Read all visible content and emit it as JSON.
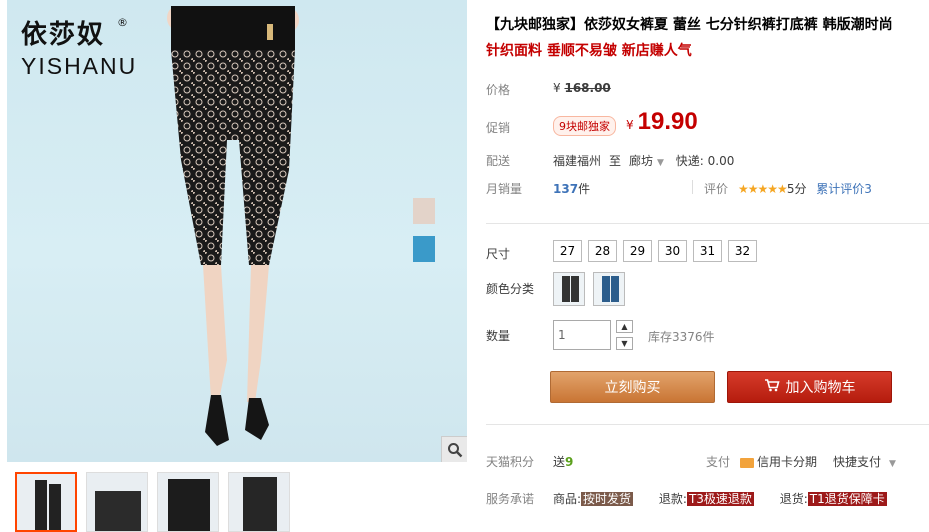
{
  "brand": {
    "name_cn": "依莎奴",
    "name_en": "YISHANU",
    "reg_mark": "®"
  },
  "product": {
    "title": "【九块邮独家】依莎奴女裤夏 蕾丝 七分针织裤打底裤 韩版潮时尚",
    "subtitle": "针织面料 垂顺不易皱 新店赚人气"
  },
  "price": {
    "label": "价格",
    "currency": "¥",
    "original": "168.00"
  },
  "promo": {
    "label": "促销",
    "badge": "9块邮独家",
    "currency": "¥",
    "price": "19.90"
  },
  "shipping": {
    "label": "配送",
    "from": "福建福州",
    "to_word": "至",
    "to": "廊坊",
    "express": "快递: 0.00"
  },
  "sales": {
    "label": "月销量",
    "count": "137",
    "unit": "件"
  },
  "rating": {
    "label": "评价",
    "stars": "★★★★★",
    "score": "5分",
    "cumulative_label": "累计评价",
    "cumulative_count": "3"
  },
  "sizes": {
    "label": "尺寸",
    "options": [
      "27",
      "28",
      "29",
      "30",
      "31",
      "32"
    ]
  },
  "colors": {
    "label": "颜色分类"
  },
  "quantity": {
    "label": "数量",
    "value": "1",
    "stock": "库存3376件"
  },
  "buttons": {
    "buy_now": "立刻购买",
    "add_to_cart": "加入购物车"
  },
  "tmall_points": {
    "label": "天猫积分",
    "send": "送",
    "points": "9"
  },
  "payment": {
    "label": "支付",
    "credit": "信用卡分期",
    "quick": "快捷支付"
  },
  "service": {
    "label": "服务承诺",
    "goods_label": "商品:",
    "goods_tag": "按时发货",
    "refund_label": "退款:",
    "refund_tag": "T3极速退款",
    "return_label": "退货:",
    "return_tag": "T1退货保障卡"
  },
  "colors_palette": {
    "accent_red": "#c40000",
    "buy_orange": "#c97534",
    "cart_red": "#b51c0e",
    "link_blue": "#3e73b8"
  }
}
